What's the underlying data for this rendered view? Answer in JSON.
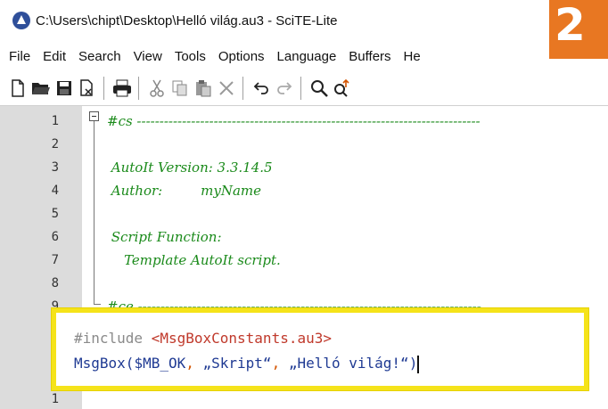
{
  "window": {
    "title": "C:\\Users\\chipt\\Desktop\\Helló világ.au3 - SciTE-Lite"
  },
  "badge": {
    "text": "2",
    "color": "#e87722"
  },
  "menu": [
    "File",
    "Edit",
    "Search",
    "View",
    "Tools",
    "Options",
    "Language",
    "Buffers",
    "He"
  ],
  "toolbar": {
    "icons": [
      "new-file-icon",
      "open-folder-icon",
      "save-icon",
      "close-file-icon",
      "print-icon",
      "cut-icon",
      "copy-icon",
      "paste-icon",
      "delete-icon",
      "undo-icon",
      "redo-icon",
      "find-icon",
      "replace-icon"
    ]
  },
  "editor": {
    "lines": [
      {
        "num": "1",
        "text": "#cs ----------------------------------------------------------------------------"
      },
      {
        "num": "2",
        "text": ""
      },
      {
        "num": "3",
        "text": " AutoIt Version: 3.3.14.5"
      },
      {
        "num": "4",
        "text": " Author:         myName"
      },
      {
        "num": "5",
        "text": ""
      },
      {
        "num": "6",
        "text": " Script Function:"
      },
      {
        "num": "7",
        "text": "    Template AutoIt script."
      },
      {
        "num": "8",
        "text": ""
      },
      {
        "num": "9",
        "text": "#ce ----------------------------------------------------------------------------"
      },
      {
        "num": "1",
        "text": ""
      },
      {
        "num": "1",
        "text": ""
      },
      {
        "num": "1",
        "text": ""
      },
      {
        "num": "1",
        "text": ""
      }
    ],
    "highlight": {
      "line1_directive": "#include",
      "line1_file": "<MsgBoxConstants.au3>",
      "line2_fn": "MsgBox",
      "line2_open": "(",
      "line2_var": "$MB_OK",
      "line2_sep1": ", ",
      "line2_str1": "„Skript“",
      "line2_sep2": ", ",
      "line2_str2": "„Helló világ!“",
      "line2_close": ")"
    }
  }
}
